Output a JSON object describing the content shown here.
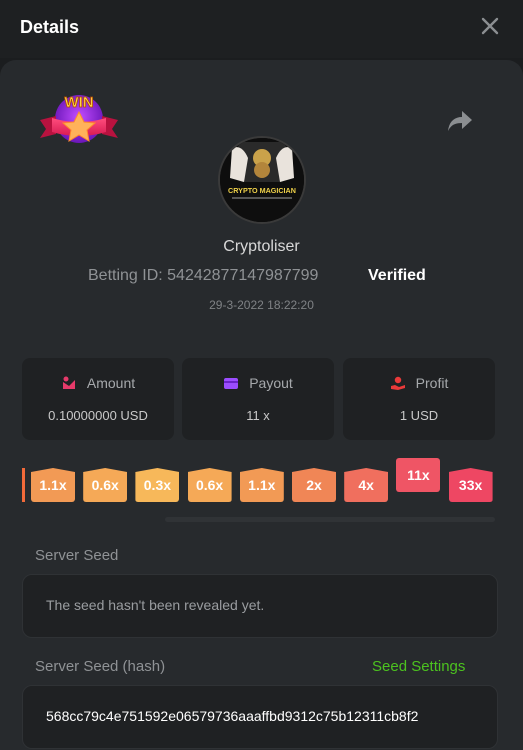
{
  "header": {
    "title": "Details"
  },
  "bet": {
    "username": "Cryptoliser",
    "betting_id_label": "Betting ID: 54242877147987799",
    "verified_label": "Verified",
    "datetime": "29-3-2022 18:22:20",
    "badge_text": "WIN",
    "avatar_caption": "CRYPTO MAGICIAN"
  },
  "stats": {
    "amount": {
      "label": "Amount",
      "value": "0.10000000 USD"
    },
    "payout": {
      "label": "Payout",
      "value": "11 x"
    },
    "profit": {
      "label": "Profit",
      "value": "1 USD"
    }
  },
  "multipliers": [
    {
      "label": "1.1x",
      "color": "#f29a55"
    },
    {
      "label": "0.6x",
      "color": "#f5a957"
    },
    {
      "label": "0.3x",
      "color": "#f7b85a"
    },
    {
      "label": "0.6x",
      "color": "#f5a957"
    },
    {
      "label": "1.1x",
      "color": "#f29a55"
    },
    {
      "label": "2x",
      "color": "#f08656"
    },
    {
      "label": "4x",
      "color": "#f06f5e"
    },
    {
      "label": "11x",
      "color": "#ef5565",
      "active": true
    },
    {
      "label": "33x",
      "color": "#ee4763"
    }
  ],
  "server_seed": {
    "label": "Server Seed",
    "value": "The seed hasn't been revealed yet."
  },
  "server_seed_hash": {
    "label": "Server Seed (hash)",
    "settings_label": "Seed Settings",
    "value": "568cc79c4e751592e06579736aaaffbd9312c75b12311cb8f2"
  },
  "colors": {
    "accent_green": "#4cc21f",
    "panel": "#272a2d",
    "card": "#1f2123"
  }
}
